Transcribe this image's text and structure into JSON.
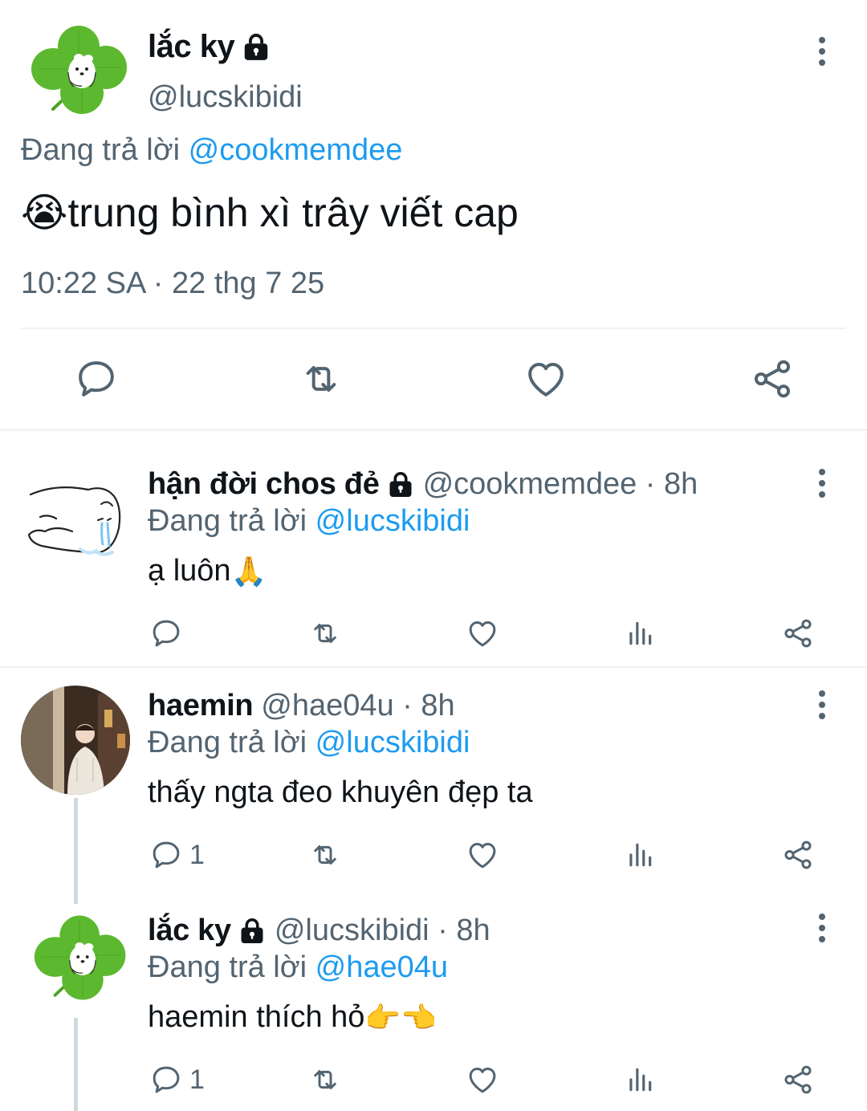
{
  "main_tweet": {
    "display_name": "lắc ky",
    "handle": "@lucskibidi",
    "replying_prefix": "Đang trả lời",
    "replying_to": "@cookmemdee",
    "emoji": "😭",
    "text": "trung bình xì trây viết cap",
    "timestamp": "10:22 SA · 22 thg 7 25",
    "icons": [
      "comment-icon",
      "retweet-icon",
      "heart-icon",
      "share-icon"
    ]
  },
  "replies": [
    {
      "display_name": "hận đời chos đẻ",
      "meta": "@cookmemdee · 8h",
      "replying_prefix": "Đang trả lời",
      "replying_to": "@lucskibidi",
      "text": "ạ luôn",
      "emoji": "🙏",
      "reply_count": ""
    },
    {
      "display_name": "haemin",
      "meta": "@hae04u · 8h",
      "replying_prefix": "Đang trả lời",
      "replying_to": "@lucskibidi",
      "text": "thấy ngta đeo khuyên đẹp ta",
      "emoji": "",
      "reply_count": "1"
    },
    {
      "display_name": "lắc ky",
      "meta": "@lucskibidi · 8h",
      "replying_prefix": "Đang trả lời",
      "replying_to": "@hae04u",
      "text": "haemin thích hỏ",
      "emoji": "👉👈",
      "reply_count": "1"
    }
  ],
  "colors": {
    "accent": "#1d9bf0",
    "secondary_text": "#536471",
    "divider": "#eff3f4",
    "clover": "#5cb82e"
  }
}
